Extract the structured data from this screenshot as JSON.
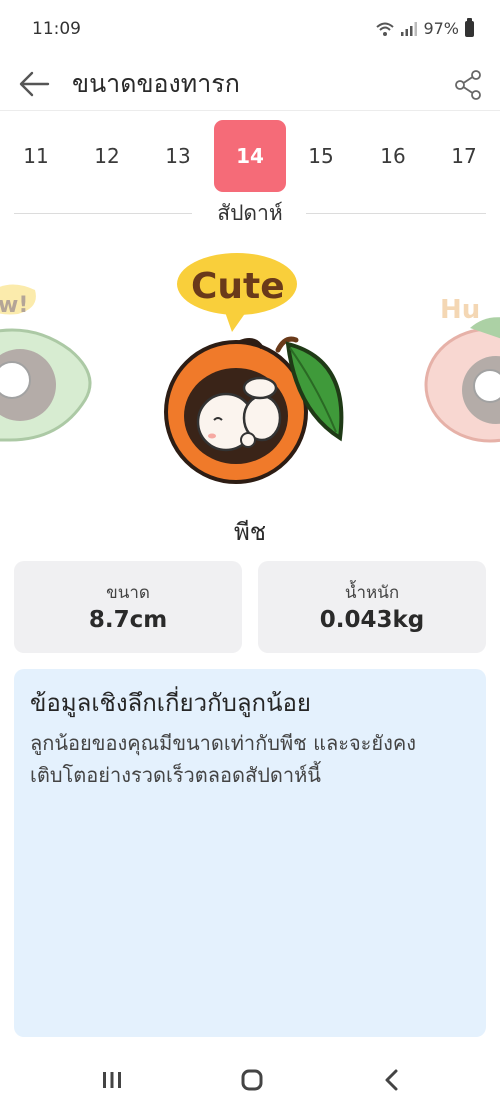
{
  "status_bar": {
    "time": "11:09",
    "battery": "97%"
  },
  "header": {
    "title": "ขนาดของทารก"
  },
  "weeks": {
    "items": [
      "11",
      "12",
      "13",
      "14",
      "15",
      "16",
      "17"
    ],
    "selected": "14",
    "caption": "สัปดาห์"
  },
  "carousel": {
    "left_badge": "w!",
    "center_badge": "Cute",
    "right_badge": "Hu"
  },
  "fruit": {
    "name": "พีช"
  },
  "stats": {
    "size_label": "ขนาด",
    "size_value": "8.7cm",
    "weight_label": "น้ำหนัก",
    "weight_value": "0.043kg"
  },
  "insight": {
    "title": "ข้อมูลเชิงลึกเกี่ยวกับลูกน้อย",
    "body": "ลูกน้อยของคุณมีขนาดเท่ากับพีช และจะยังคงเติบโตอย่างรวดเร็วตลอดสัปดาห์นี้"
  },
  "colors": {
    "accent": "#f56b78",
    "insight_bg": "#e4f1fd",
    "card_bg": "#f0f0f2",
    "peach": "#f07a2a",
    "leaf": "#3f9a3a"
  }
}
